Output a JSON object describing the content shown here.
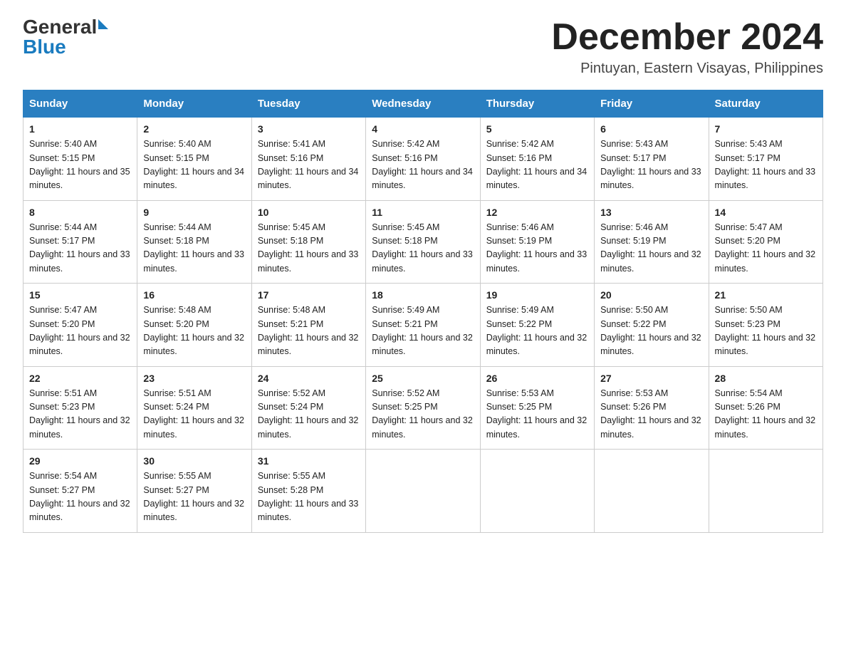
{
  "header": {
    "logo_general": "General",
    "logo_blue": "Blue",
    "title": "December 2024",
    "location": "Pintuyan, Eastern Visayas, Philippines"
  },
  "days_of_week": [
    "Sunday",
    "Monday",
    "Tuesday",
    "Wednesday",
    "Thursday",
    "Friday",
    "Saturday"
  ],
  "weeks": [
    [
      {
        "day": "1",
        "sunrise": "5:40 AM",
        "sunset": "5:15 PM",
        "daylight": "11 hours and 35 minutes."
      },
      {
        "day": "2",
        "sunrise": "5:40 AM",
        "sunset": "5:15 PM",
        "daylight": "11 hours and 34 minutes."
      },
      {
        "day": "3",
        "sunrise": "5:41 AM",
        "sunset": "5:16 PM",
        "daylight": "11 hours and 34 minutes."
      },
      {
        "day": "4",
        "sunrise": "5:42 AM",
        "sunset": "5:16 PM",
        "daylight": "11 hours and 34 minutes."
      },
      {
        "day": "5",
        "sunrise": "5:42 AM",
        "sunset": "5:16 PM",
        "daylight": "11 hours and 34 minutes."
      },
      {
        "day": "6",
        "sunrise": "5:43 AM",
        "sunset": "5:17 PM",
        "daylight": "11 hours and 33 minutes."
      },
      {
        "day": "7",
        "sunrise": "5:43 AM",
        "sunset": "5:17 PM",
        "daylight": "11 hours and 33 minutes."
      }
    ],
    [
      {
        "day": "8",
        "sunrise": "5:44 AM",
        "sunset": "5:17 PM",
        "daylight": "11 hours and 33 minutes."
      },
      {
        "day": "9",
        "sunrise": "5:44 AM",
        "sunset": "5:18 PM",
        "daylight": "11 hours and 33 minutes."
      },
      {
        "day": "10",
        "sunrise": "5:45 AM",
        "sunset": "5:18 PM",
        "daylight": "11 hours and 33 minutes."
      },
      {
        "day": "11",
        "sunrise": "5:45 AM",
        "sunset": "5:18 PM",
        "daylight": "11 hours and 33 minutes."
      },
      {
        "day": "12",
        "sunrise": "5:46 AM",
        "sunset": "5:19 PM",
        "daylight": "11 hours and 33 minutes."
      },
      {
        "day": "13",
        "sunrise": "5:46 AM",
        "sunset": "5:19 PM",
        "daylight": "11 hours and 32 minutes."
      },
      {
        "day": "14",
        "sunrise": "5:47 AM",
        "sunset": "5:20 PM",
        "daylight": "11 hours and 32 minutes."
      }
    ],
    [
      {
        "day": "15",
        "sunrise": "5:47 AM",
        "sunset": "5:20 PM",
        "daylight": "11 hours and 32 minutes."
      },
      {
        "day": "16",
        "sunrise": "5:48 AM",
        "sunset": "5:20 PM",
        "daylight": "11 hours and 32 minutes."
      },
      {
        "day": "17",
        "sunrise": "5:48 AM",
        "sunset": "5:21 PM",
        "daylight": "11 hours and 32 minutes."
      },
      {
        "day": "18",
        "sunrise": "5:49 AM",
        "sunset": "5:21 PM",
        "daylight": "11 hours and 32 minutes."
      },
      {
        "day": "19",
        "sunrise": "5:49 AM",
        "sunset": "5:22 PM",
        "daylight": "11 hours and 32 minutes."
      },
      {
        "day": "20",
        "sunrise": "5:50 AM",
        "sunset": "5:22 PM",
        "daylight": "11 hours and 32 minutes."
      },
      {
        "day": "21",
        "sunrise": "5:50 AM",
        "sunset": "5:23 PM",
        "daylight": "11 hours and 32 minutes."
      }
    ],
    [
      {
        "day": "22",
        "sunrise": "5:51 AM",
        "sunset": "5:23 PM",
        "daylight": "11 hours and 32 minutes."
      },
      {
        "day": "23",
        "sunrise": "5:51 AM",
        "sunset": "5:24 PM",
        "daylight": "11 hours and 32 minutes."
      },
      {
        "day": "24",
        "sunrise": "5:52 AM",
        "sunset": "5:24 PM",
        "daylight": "11 hours and 32 minutes."
      },
      {
        "day": "25",
        "sunrise": "5:52 AM",
        "sunset": "5:25 PM",
        "daylight": "11 hours and 32 minutes."
      },
      {
        "day": "26",
        "sunrise": "5:53 AM",
        "sunset": "5:25 PM",
        "daylight": "11 hours and 32 minutes."
      },
      {
        "day": "27",
        "sunrise": "5:53 AM",
        "sunset": "5:26 PM",
        "daylight": "11 hours and 32 minutes."
      },
      {
        "day": "28",
        "sunrise": "5:54 AM",
        "sunset": "5:26 PM",
        "daylight": "11 hours and 32 minutes."
      }
    ],
    [
      {
        "day": "29",
        "sunrise": "5:54 AM",
        "sunset": "5:27 PM",
        "daylight": "11 hours and 32 minutes."
      },
      {
        "day": "30",
        "sunrise": "5:55 AM",
        "sunset": "5:27 PM",
        "daylight": "11 hours and 32 minutes."
      },
      {
        "day": "31",
        "sunrise": "5:55 AM",
        "sunset": "5:28 PM",
        "daylight": "11 hours and 33 minutes."
      },
      null,
      null,
      null,
      null
    ]
  ]
}
